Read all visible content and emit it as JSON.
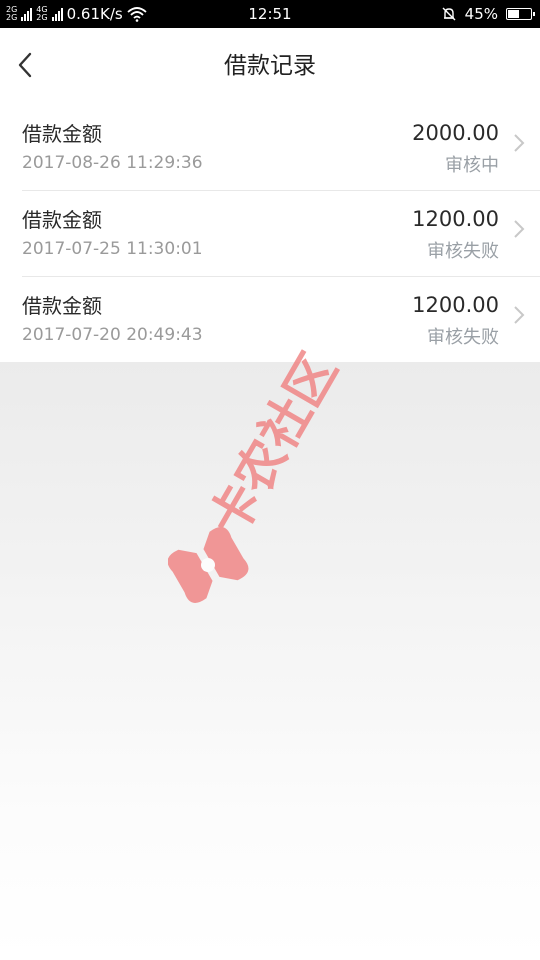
{
  "status_bar": {
    "net_top": "2G",
    "net_mid": "4G",
    "net_bottom": "2G",
    "speed": "0.61K/s",
    "time": "12:51",
    "battery_percent": "45%",
    "battery_level": 0.45,
    "icons": [
      "signal-bars-icon",
      "wifi-icon",
      "alarm-off-icon",
      "battery-icon"
    ]
  },
  "header": {
    "title": "借款记录",
    "back_icon": "chevron-left-icon"
  },
  "records": [
    {
      "label": "借款金额",
      "date": "2017-08-26 11:29:36",
      "amount": "2000.00",
      "status": "审核中"
    },
    {
      "label": "借款金额",
      "date": "2017-07-25 11:30:01",
      "amount": "1200.00",
      "status": "审核失败"
    },
    {
      "label": "借款金额",
      "date": "2017-07-20 20:49:43",
      "amount": "1200.00",
      "status": "审核失败"
    }
  ],
  "watermark": {
    "text": "卡农社区",
    "color": "#f08080"
  },
  "colors": {
    "status_bar": "#000000",
    "page_background": "#ebebeb",
    "primary_text": "#2a2a2a",
    "secondary_text": "#9a9a9a"
  }
}
